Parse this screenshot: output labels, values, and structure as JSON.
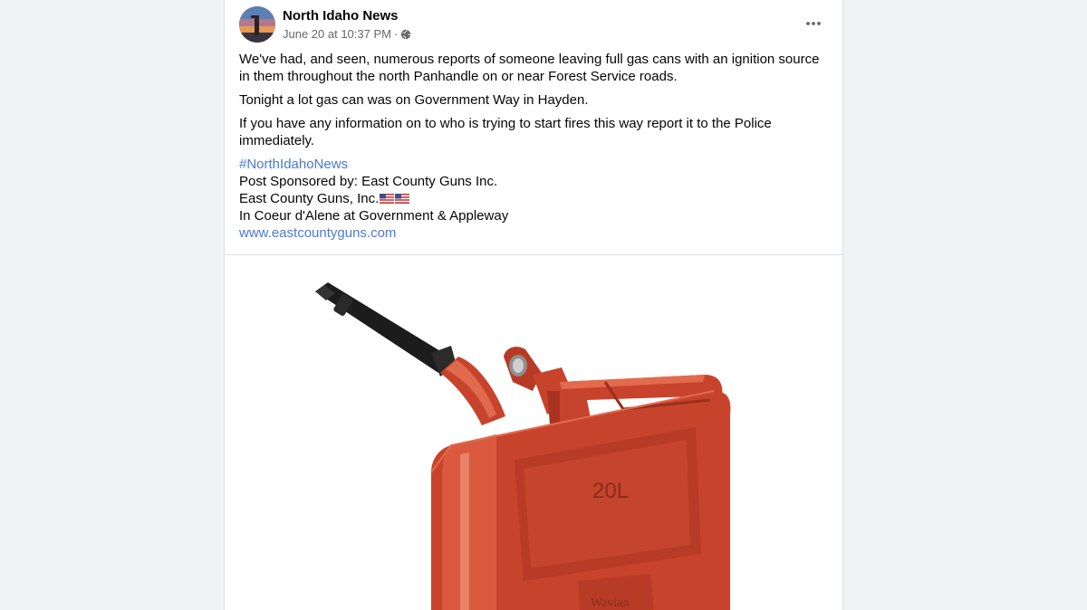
{
  "post": {
    "author": "North Idaho News",
    "timestamp": "June 20 at 10:37 PM",
    "separator": "·",
    "audience_icon": "globe-icon",
    "more_icon": "ellipsis-icon",
    "paragraphs": [
      "We've had, and seen, numerous reports of someone leaving full gas cans with an ignition source in them throughout the north Panhandle on or near Forest Service roads.",
      "Tonight a lot gas can was on Government Way in Hayden.",
      "If you have any information on to who is trying to start fires this way report it to the Police immediately."
    ],
    "hashtag": "#NorthIdahoNews",
    "sponsor_line": "Post Sponsored by: East County Guns Inc.",
    "business_name": "East County Guns, Inc.",
    "location_line": "In Coeur d'Alene at Government & Appleway",
    "website": "www.eastcountyguns.com"
  },
  "image": {
    "subject": "red gas can",
    "can_label": "20L",
    "brand_text": "Wavian",
    "can_color": "#c8432b",
    "spout_color": "#1a1a1a"
  },
  "colors": {
    "link": "#4a7ad1",
    "text": "#050505",
    "meta": "#65676b",
    "background": "#f0f2f5"
  }
}
